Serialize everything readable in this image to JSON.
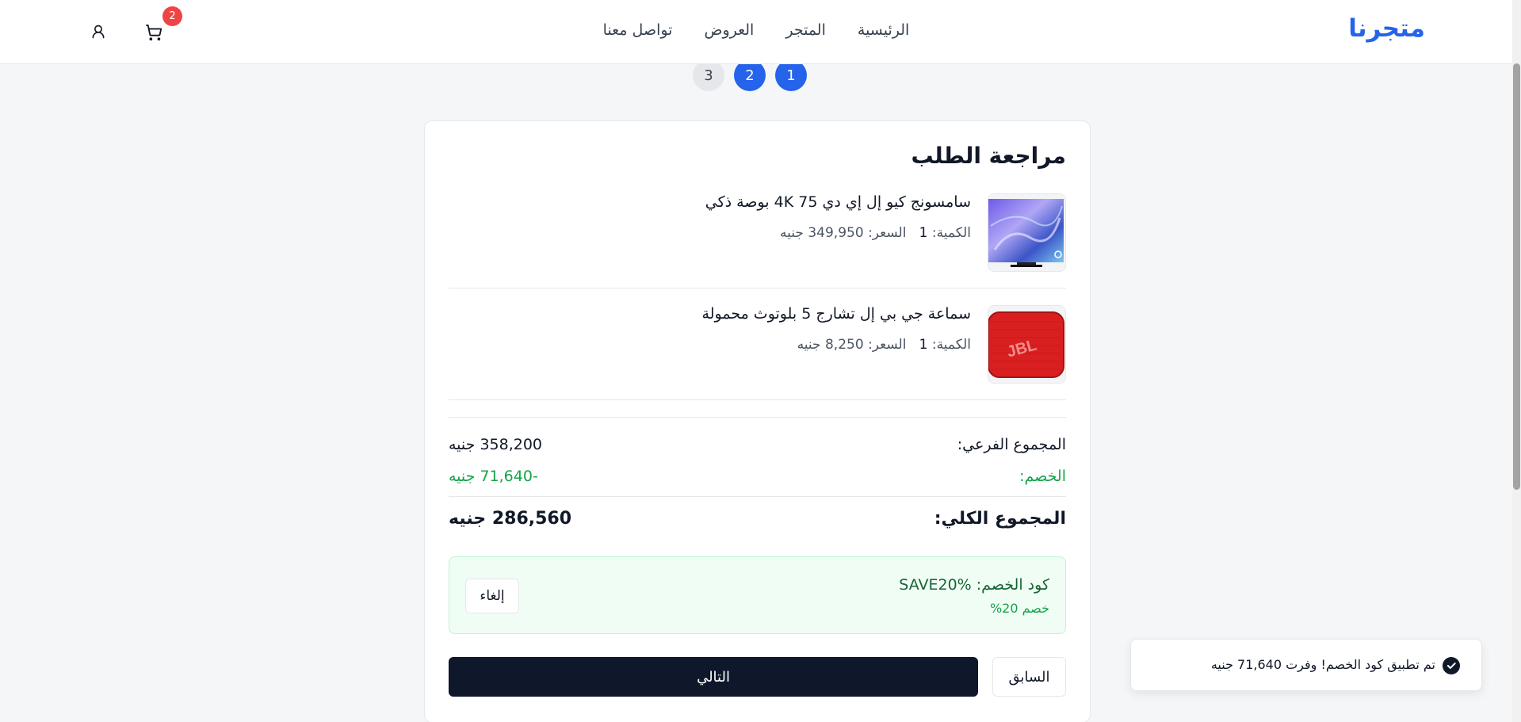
{
  "header": {
    "logo": "متجرنا",
    "nav": [
      "الرئيسية",
      "المتجر",
      "العروض",
      "تواصل معنا"
    ],
    "cart_count": "2"
  },
  "steps": [
    "1",
    "2",
    "3"
  ],
  "review": {
    "title": "مراجعة الطلب",
    "items": [
      {
        "name": "سامسونج كيو إل إي دي 75 4K بوصة ذكي",
        "qty_label": "الكمية:",
        "qty": "1",
        "price_label": "السعر:",
        "price": "349,950 جنيه",
        "image_icon": "tv-image"
      },
      {
        "name": "سماعة جي بي إل تشارج 5 بلوتوث محمولة",
        "qty_label": "الكمية:",
        "qty": "1",
        "price_label": "السعر:",
        "price": "8,250 جنيه",
        "image_icon": "speaker-image"
      }
    ],
    "subtotal_label": "المجموع الفرعي:",
    "subtotal": "358,200 جنيه",
    "discount_label": "الخصم:",
    "discount": "-71,640 جنيه",
    "total_label": "المجموع الكلي:",
    "total": "286,560 جنيه",
    "promo": {
      "code_text": "كود الخصم: SAVE20%",
      "sub": "خصم 20%",
      "cancel": "إلغاء"
    },
    "prev": "السابق",
    "next": "التالي"
  },
  "toast": {
    "text": "تم تطبيق كود الخصم! وفرت 71,640 جنيه"
  },
  "colors": {
    "brand": "#2563eb",
    "success": "#16a34a",
    "badge": "#ef4444",
    "primary_button": "#0f172a"
  }
}
